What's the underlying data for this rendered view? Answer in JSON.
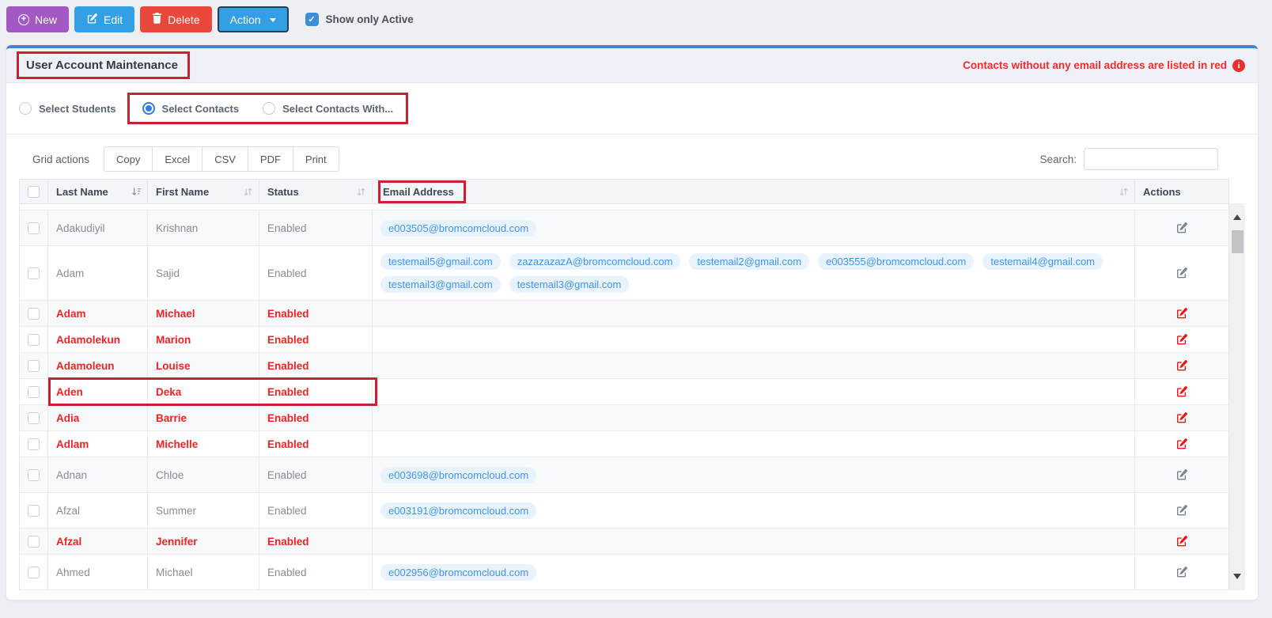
{
  "toolbar": {
    "new_label": "New",
    "edit_label": "Edit",
    "delete_label": "Delete",
    "action_label": "Action",
    "show_only_active_label": "Show only Active",
    "show_only_active_checked": true
  },
  "panel": {
    "title": "User Account Maintenance",
    "note": "Contacts without any email address are listed in red"
  },
  "filters": {
    "radios": [
      {
        "label": "Select Students",
        "selected": false
      },
      {
        "label": "Select Contacts",
        "selected": true
      },
      {
        "label": "Select Contacts With...",
        "selected": false
      }
    ]
  },
  "grid_actions": {
    "label": "Grid actions",
    "buttons": [
      "Copy",
      "Excel",
      "CSV",
      "PDF",
      "Print"
    ],
    "search_label": "Search:",
    "search_value": ""
  },
  "table": {
    "columns": [
      "Last Name",
      "First Name",
      "Status",
      "Email Address",
      "Actions"
    ],
    "sort": {
      "column": "Last Name",
      "direction": "asc"
    },
    "rows": [
      {
        "last": "Adakudiyil",
        "first": "Krishnan",
        "status": "Enabled",
        "emails": [
          "e003505@bromcomcloud.com"
        ],
        "red": false,
        "annotated": false
      },
      {
        "last": "Adam",
        "first": "Sajid",
        "status": "Enabled",
        "emails": [
          "testemail5@gmail.com",
          "zazazazazA@bromcomcloud.com",
          "testemail2@gmail.com",
          "e003555@bromcomcloud.com",
          "testemail4@gmail.com",
          "testemail3@gmail.com",
          "testemail3@gmail.com"
        ],
        "red": false,
        "annotated": false
      },
      {
        "last": "Adam",
        "first": "Michael",
        "status": "Enabled",
        "emails": [],
        "red": true,
        "annotated": false
      },
      {
        "last": "Adamolekun",
        "first": "Marion",
        "status": "Enabled",
        "emails": [],
        "red": true,
        "annotated": false
      },
      {
        "last": "Adamoleun",
        "first": "Louise",
        "status": "Enabled",
        "emails": [],
        "red": true,
        "annotated": false
      },
      {
        "last": "Aden",
        "first": "Deka",
        "status": "Enabled",
        "emails": [],
        "red": true,
        "annotated": true
      },
      {
        "last": "Adia",
        "first": "Barrie",
        "status": "Enabled",
        "emails": [],
        "red": true,
        "annotated": false
      },
      {
        "last": "Adlam",
        "first": "Michelle",
        "status": "Enabled",
        "emails": [],
        "red": true,
        "annotated": false
      },
      {
        "last": "Adnan",
        "first": "Chloe",
        "status": "Enabled",
        "emails": [
          "e003698@bromcomcloud.com"
        ],
        "red": false,
        "annotated": false
      },
      {
        "last": "Afzal",
        "first": "Summer",
        "status": "Enabled",
        "emails": [
          "e003191@bromcomcloud.com"
        ],
        "red": false,
        "annotated": false
      },
      {
        "last": "Afzal",
        "first": "Jennifer",
        "status": "Enabled",
        "emails": [],
        "red": true,
        "annotated": false
      },
      {
        "last": "Ahmed",
        "first": "Michael",
        "status": "Enabled",
        "emails": [
          "e002956@bromcomcloud.com"
        ],
        "red": false,
        "annotated": false
      }
    ]
  },
  "colors": {
    "new_button": "#a259c4",
    "edit_button": "#339fe5",
    "delete_button": "#e8493a",
    "card_accent_border": "#4285d6",
    "annotation_red": "#cb2030",
    "red_row_text": "#f32222",
    "email_link": "#3f94f5",
    "email_pill_bg": "#e9f3fe",
    "note_red": "#ee2d2d"
  }
}
